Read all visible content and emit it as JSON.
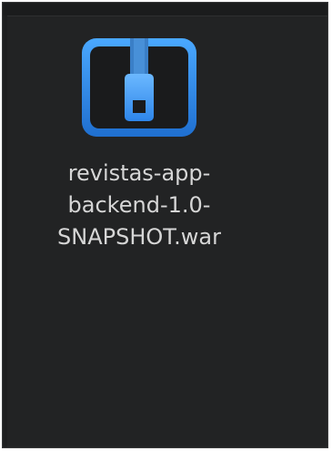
{
  "file": {
    "name_lines": [
      "revistas-app-",
      "backend-1.0-",
      "SNAPSHOT.war"
    ],
    "icon": "archive-zip-icon",
    "selected": false
  },
  "colors": {
    "background": "#222324",
    "icon_blue": "#2f8ff0",
    "text": "#d6d6d6"
  }
}
